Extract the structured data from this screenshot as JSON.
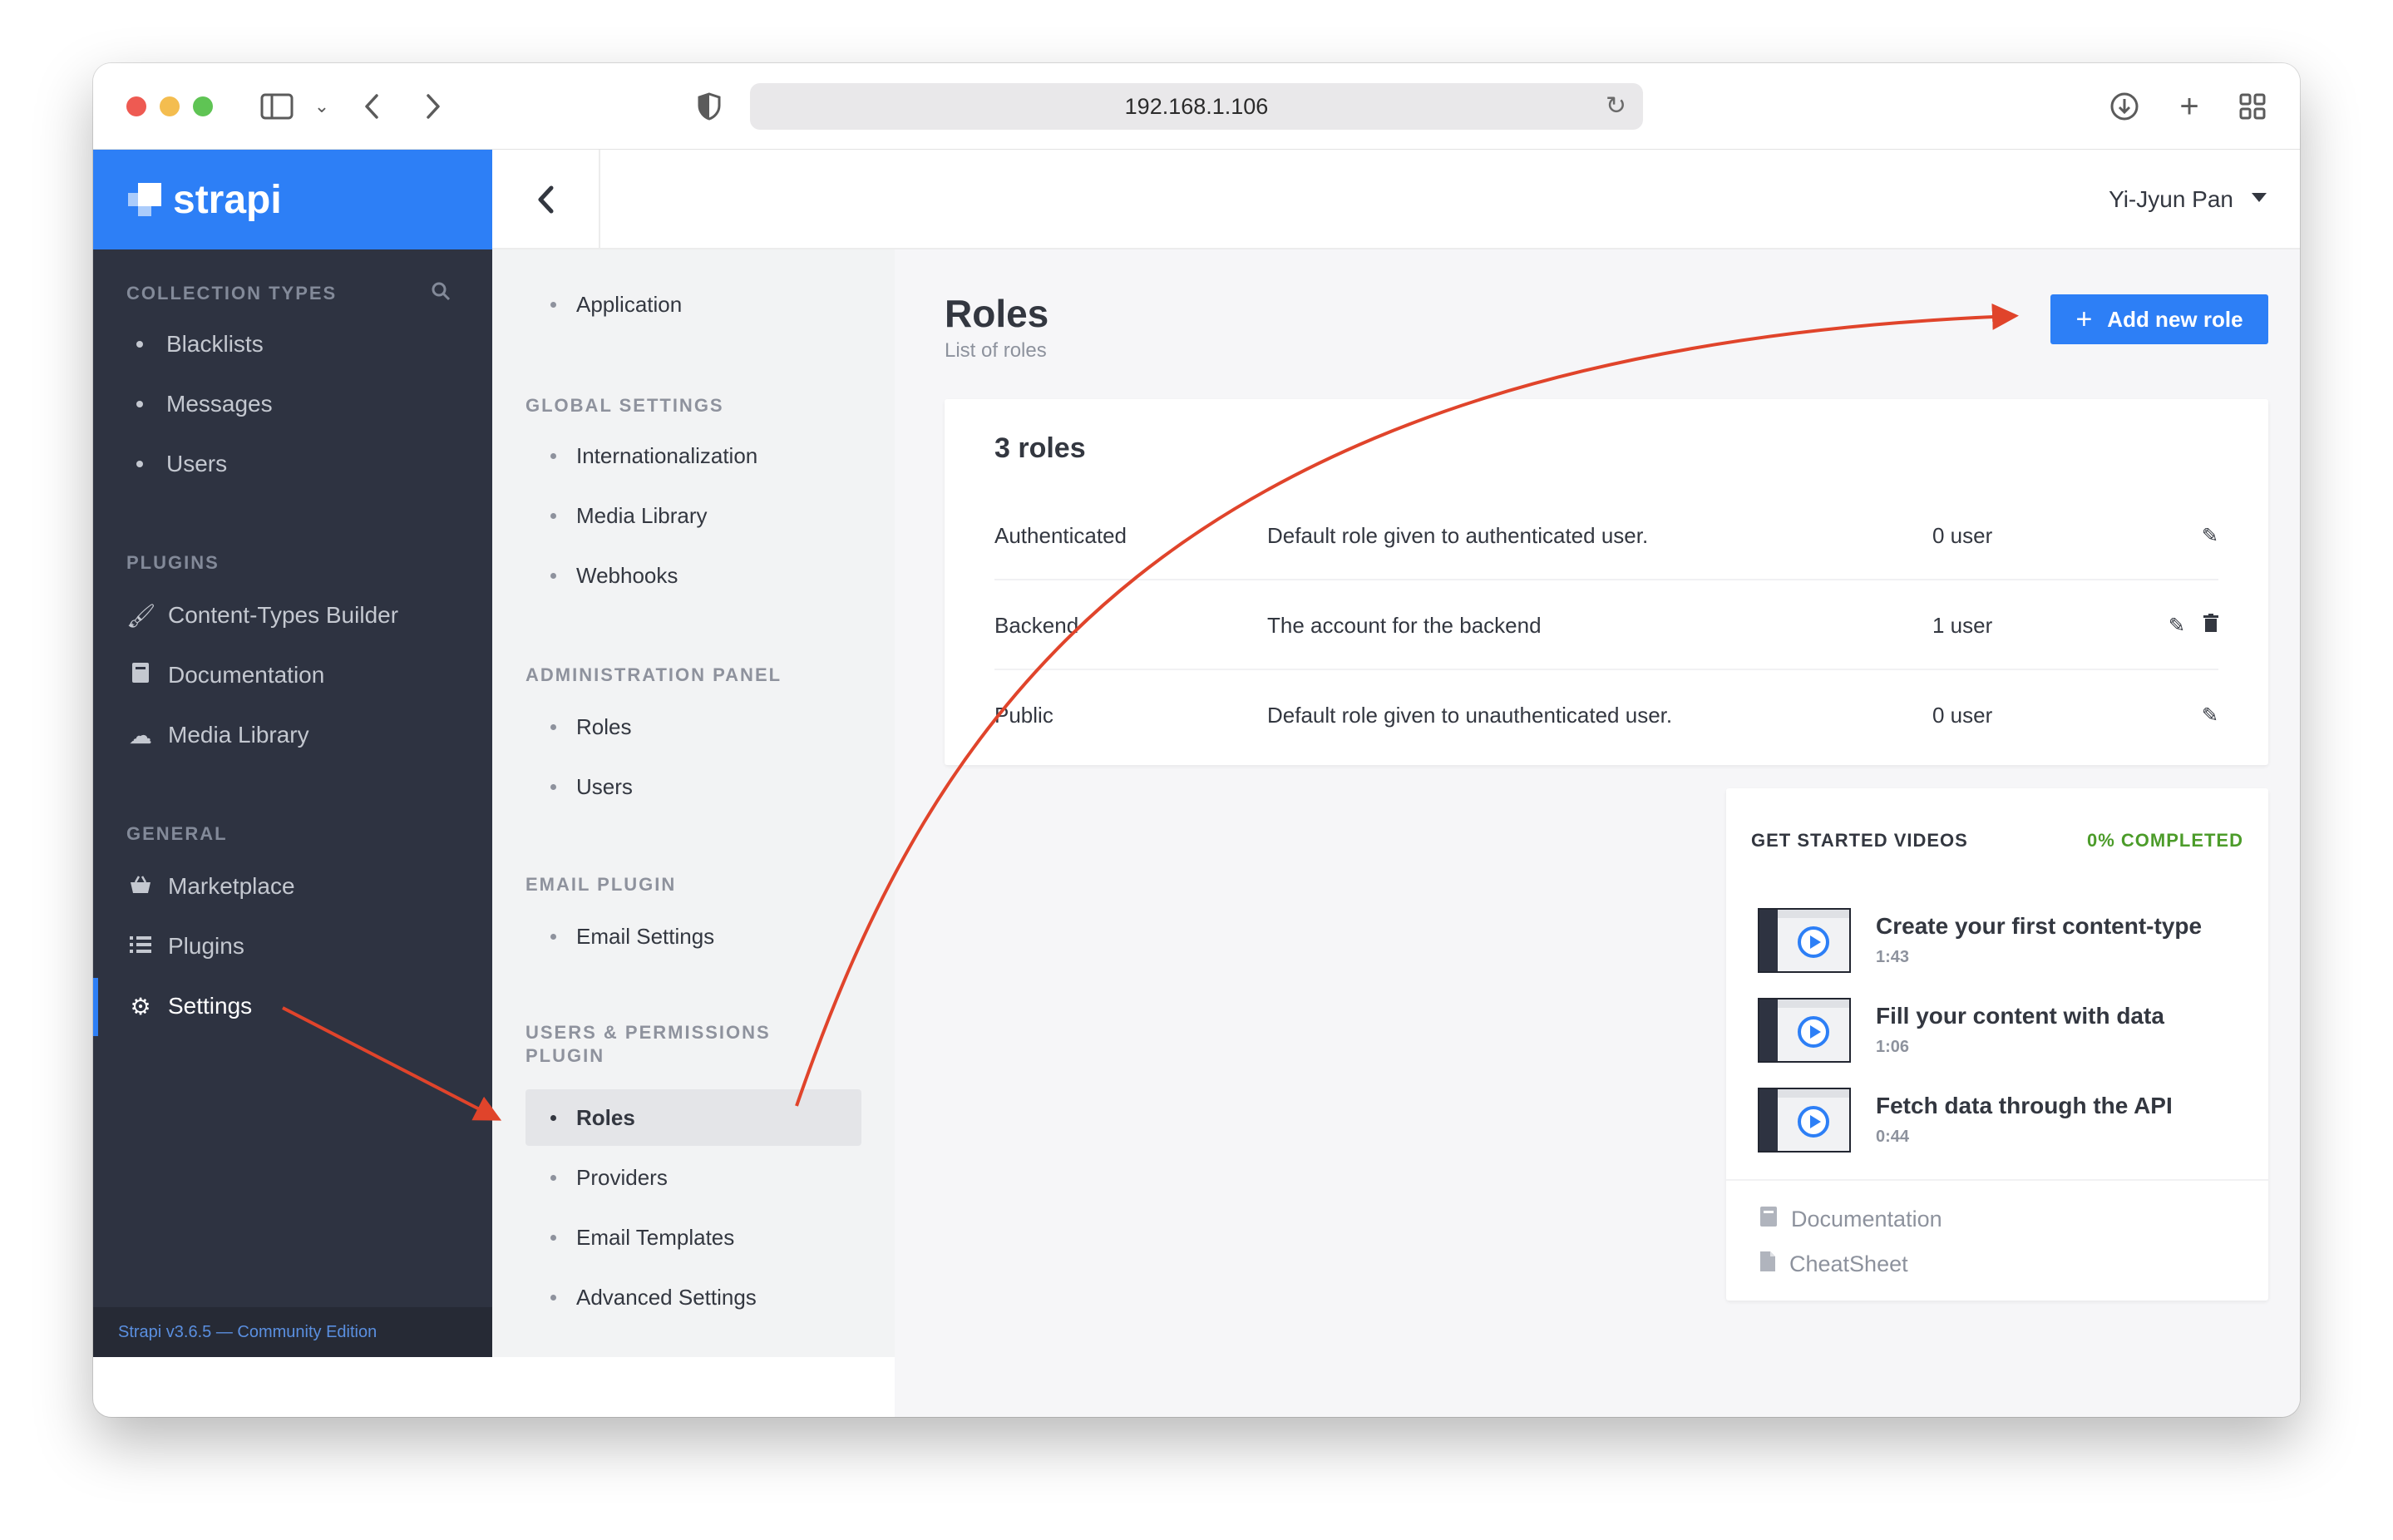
{
  "browser": {
    "url": "192.168.1.106"
  },
  "brand": {
    "name": "strapi"
  },
  "header": {
    "user_name": "Yi-Jyun Pan"
  },
  "sidebar": {
    "collection_types_title": "COLLECTION TYPES",
    "collection_types": [
      "Blacklists",
      "Messages",
      "Users"
    ],
    "plugins_title": "PLUGINS",
    "plugins": [
      {
        "label": "Content-Types Builder",
        "icon": "brush-icon"
      },
      {
        "label": "Documentation",
        "icon": "book-icon"
      },
      {
        "label": "Media Library",
        "icon": "cloud-upload-icon"
      }
    ],
    "general_title": "GENERAL",
    "general": [
      {
        "label": "Marketplace",
        "icon": "basket-icon"
      },
      {
        "label": "Plugins",
        "icon": "list-icon"
      },
      {
        "label": "Settings",
        "icon": "gear-icon"
      }
    ],
    "footer": "Strapi v3.6.5 — Community Edition"
  },
  "subnav": {
    "application": "Application",
    "global_title": "GLOBAL SETTINGS",
    "global": [
      "Internationalization",
      "Media Library",
      "Webhooks"
    ],
    "admin_title": "ADMINISTRATION PANEL",
    "admin": [
      "Roles",
      "Users"
    ],
    "email_title": "EMAIL PLUGIN",
    "email": [
      "Email Settings"
    ],
    "up_title_line1": "USERS & PERMISSIONS",
    "up_title_line2": "PLUGIN",
    "up": [
      "Roles",
      "Providers",
      "Email Templates",
      "Advanced Settings"
    ]
  },
  "main": {
    "title": "Roles",
    "subtitle": "List of roles",
    "add_button": "Add new role",
    "roles_count": "3 roles",
    "roles": [
      {
        "name": "Authenticated",
        "description": "Default role given to authenticated user.",
        "users": "0 user",
        "deletable": false
      },
      {
        "name": "Backend",
        "description": "The account for the backend",
        "users": "1 user",
        "deletable": true
      },
      {
        "name": "Public",
        "description": "Default role given to unauthenticated user.",
        "users": "0 user",
        "deletable": false
      }
    ]
  },
  "videos": {
    "title": "GET STARTED VIDEOS",
    "progress": "0% COMPLETED",
    "items": [
      {
        "title": "Create your first content-type",
        "duration": "1:43"
      },
      {
        "title": "Fill your content with data",
        "duration": "1:06"
      },
      {
        "title": "Fetch data through the API",
        "duration": "0:44"
      }
    ],
    "links": [
      "Documentation",
      "CheatSheet"
    ]
  },
  "colors": {
    "accent": "#2d7ff6",
    "sidebar": "#2e3341",
    "annotation_arrow": "#e0442b",
    "completed": "#4c9c2a"
  }
}
